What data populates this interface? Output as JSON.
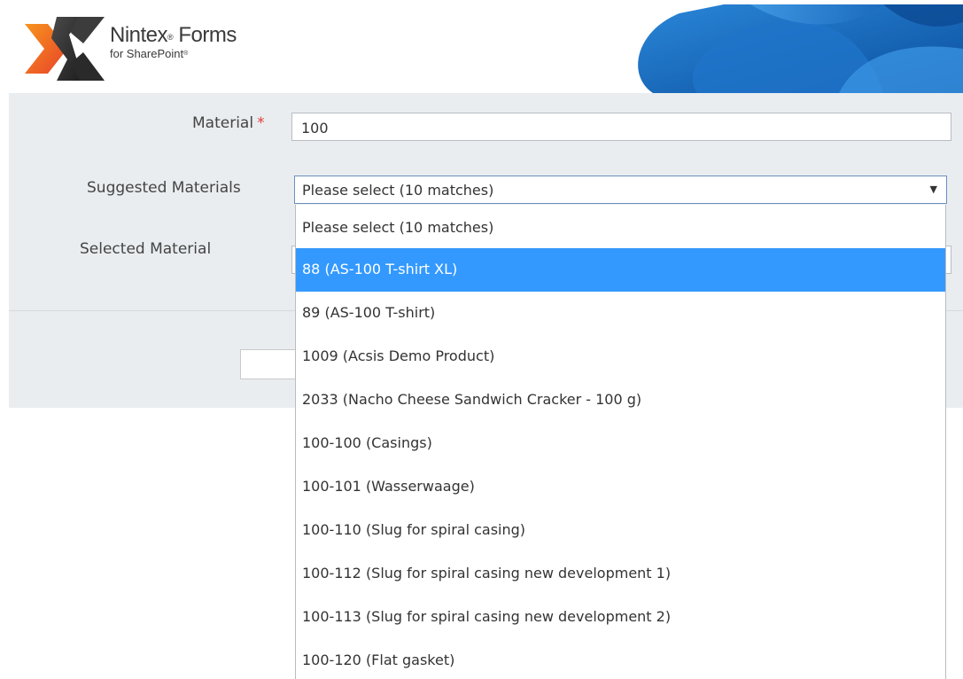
{
  "header": {
    "logo_title": "Nintex",
    "logo_title_tm": "®",
    "logo_title_rest": " Forms",
    "logo_sub": "for SharePoint",
    "logo_sub_tm": "®"
  },
  "form": {
    "material_label": "Material",
    "material_required_mark": "*",
    "material_value": "100",
    "suggested_label": "Suggested Materials",
    "suggested_selected": "Please select (10 matches)",
    "selected_material_label": "Selected Material"
  },
  "dropdown": {
    "options": [
      {
        "label": "Please select (10 matches)",
        "selected": false
      },
      {
        "label": "88 (AS-100 T-shirt XL)",
        "selected": true
      },
      {
        "label": "89 (AS-100 T-shirt)",
        "selected": false
      },
      {
        "label": "1009 (Acsis Demo Product)",
        "selected": false
      },
      {
        "label": "2033 (Nacho Cheese Sandwich Cracker - 100 g)",
        "selected": false
      },
      {
        "label": "100-100 (Casings)",
        "selected": false
      },
      {
        "label": "100-101 (Wasserwaage)",
        "selected": false
      },
      {
        "label": "100-110 (Slug for spiral casing)",
        "selected": false
      },
      {
        "label": "100-112 (Slug for spiral casing new development 1)",
        "selected": false
      },
      {
        "label": "100-113 (Slug for spiral casing new development 2)",
        "selected": false
      },
      {
        "label": "100-120 (Flat gasket)",
        "selected": false
      }
    ]
  },
  "colors": {
    "highlight": "#3399ff",
    "panel": "#eaedf0",
    "required": "#e0403a",
    "logo_orange": "#f26522",
    "logo_dark": "#2b2b2b",
    "banner_blue": "#1a6fc4"
  },
  "icons": {
    "logo": "nintex-x-logo",
    "dropdown_arrow": "caret-down-icon"
  }
}
